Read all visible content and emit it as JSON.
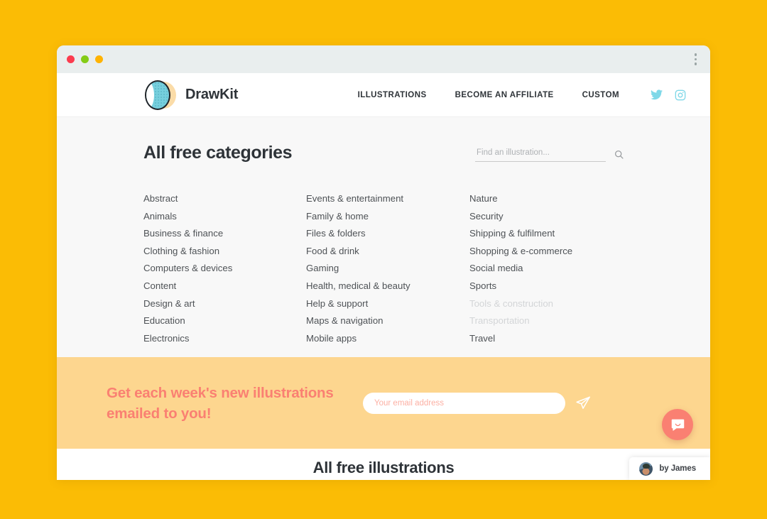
{
  "window": {
    "traffic_lights": [
      "close",
      "minimize",
      "maximize"
    ],
    "menu_icon": "kebab-menu-icon",
    "chrome_color": "#E9EEEE"
  },
  "theme": {
    "page_background": "#FBBC05",
    "content_background": "#F8F8F8",
    "newsletter_background": "#FDD68F",
    "accent_coral": "#FA8072",
    "social_blue": "#76CFDD",
    "text_dark": "#2E3338",
    "text_muted": "#D3D5D7"
  },
  "header": {
    "brand_name": "DrawKit",
    "nav": [
      {
        "label": "ILLUSTRATIONS"
      },
      {
        "label": "BECOME AN AFFILIATE"
      },
      {
        "label": "CUSTOM"
      }
    ],
    "social": [
      {
        "name": "twitter-icon"
      },
      {
        "name": "instagram-icon"
      }
    ]
  },
  "main": {
    "title": "All free categories",
    "search": {
      "placeholder": "Find an illustration...",
      "value": "",
      "icon": "search-icon"
    },
    "columns": [
      {
        "items": [
          {
            "label": "Abstract",
            "muted": false
          },
          {
            "label": "Animals",
            "muted": false
          },
          {
            "label": "Business & finance",
            "muted": false
          },
          {
            "label": "Clothing & fashion",
            "muted": false
          },
          {
            "label": "Computers & devices",
            "muted": false
          },
          {
            "label": "Content",
            "muted": false
          },
          {
            "label": "Design & art",
            "muted": false
          },
          {
            "label": "Education",
            "muted": false
          },
          {
            "label": "Electronics",
            "muted": false
          }
        ]
      },
      {
        "items": [
          {
            "label": "Events & entertainment",
            "muted": false
          },
          {
            "label": "Family & home",
            "muted": false
          },
          {
            "label": "Files & folders",
            "muted": false
          },
          {
            "label": "Food & drink",
            "muted": false
          },
          {
            "label": "Gaming",
            "muted": false
          },
          {
            "label": "Health, medical & beauty",
            "muted": false
          },
          {
            "label": "Help & support",
            "muted": false
          },
          {
            "label": "Maps & navigation",
            "muted": false
          },
          {
            "label": "Mobile apps",
            "muted": false
          }
        ]
      },
      {
        "items": [
          {
            "label": "Nature",
            "muted": false
          },
          {
            "label": "Security",
            "muted": false
          },
          {
            "label": "Shipping & fulfilment",
            "muted": false
          },
          {
            "label": "Shopping & e-commerce",
            "muted": false
          },
          {
            "label": "Social media",
            "muted": false
          },
          {
            "label": "Sports",
            "muted": false
          },
          {
            "label": "Tools & construction",
            "muted": true
          },
          {
            "label": "Transportation",
            "muted": true
          },
          {
            "label": "Travel",
            "muted": false
          }
        ]
      }
    ]
  },
  "newsletter": {
    "heading_line1": "Get each week's new illustrations",
    "heading_line2": "emailed to you!",
    "input": {
      "placeholder": "Your email address",
      "value": ""
    },
    "send_icon": "paper-plane-icon"
  },
  "bottom": {
    "title": "All free illustrations"
  },
  "widgets": {
    "chat": {
      "icon": "chat-bubble-icon"
    },
    "credit": {
      "text": "by James",
      "avatar": "user-avatar"
    }
  }
}
